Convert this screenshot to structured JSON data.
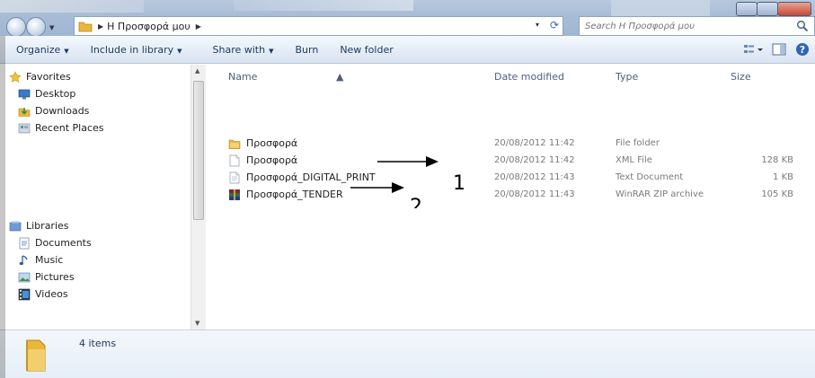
{
  "address": {
    "crumb": "Η Προσφορά μου",
    "dropdown_arrow": "▾",
    "refresh_icon": "refresh-icon"
  },
  "search": {
    "placeholder": "Search Η Προσφορά μου"
  },
  "toolbar": {
    "organize": "Organize",
    "include_in_library": "Include in library",
    "share_with": "Share with",
    "burn": "Burn",
    "new_folder": "New folder"
  },
  "nav": {
    "favorites": {
      "label": "Favorites",
      "items": [
        {
          "label": "Desktop",
          "icon": "desktop-icon"
        },
        {
          "label": "Downloads",
          "icon": "downloads-icon"
        },
        {
          "label": "Recent Places",
          "icon": "recent-places-icon"
        }
      ]
    },
    "libraries": {
      "label": "Libraries",
      "items": [
        {
          "label": "Documents",
          "icon": "documents-icon"
        },
        {
          "label": "Music",
          "icon": "music-icon"
        },
        {
          "label": "Pictures",
          "icon": "pictures-icon"
        },
        {
          "label": "Videos",
          "icon": "videos-icon"
        }
      ]
    }
  },
  "columns": {
    "name": "Name",
    "date_modified": "Date modified",
    "type": "Type",
    "size": "Size"
  },
  "files": [
    {
      "name": "Προσφορά",
      "date": "20/08/2012 11:42",
      "type": "File folder",
      "size": "",
      "icon": "folder-icon"
    },
    {
      "name": "Προσφορά",
      "date": "20/08/2012 11:42",
      "type": "XML File",
      "size": "128 KB",
      "icon": "xml-file-icon"
    },
    {
      "name": "Προσφορά_DIGITAL_PRINT",
      "date": "20/08/2012 11:43",
      "type": "Text Document",
      "size": "1 KB",
      "icon": "text-file-icon"
    },
    {
      "name": "Προσφορά_TENDER",
      "date": "20/08/2012 11:43",
      "type": "WinRAR ZIP archive",
      "size": "105 KB",
      "icon": "winrar-archive-icon"
    }
  ],
  "annotations": {
    "one": "1",
    "two": "2"
  },
  "details": {
    "count": "4 items"
  },
  "colors": {
    "accent": "#1e395b",
    "folder": "#e8b73c"
  }
}
